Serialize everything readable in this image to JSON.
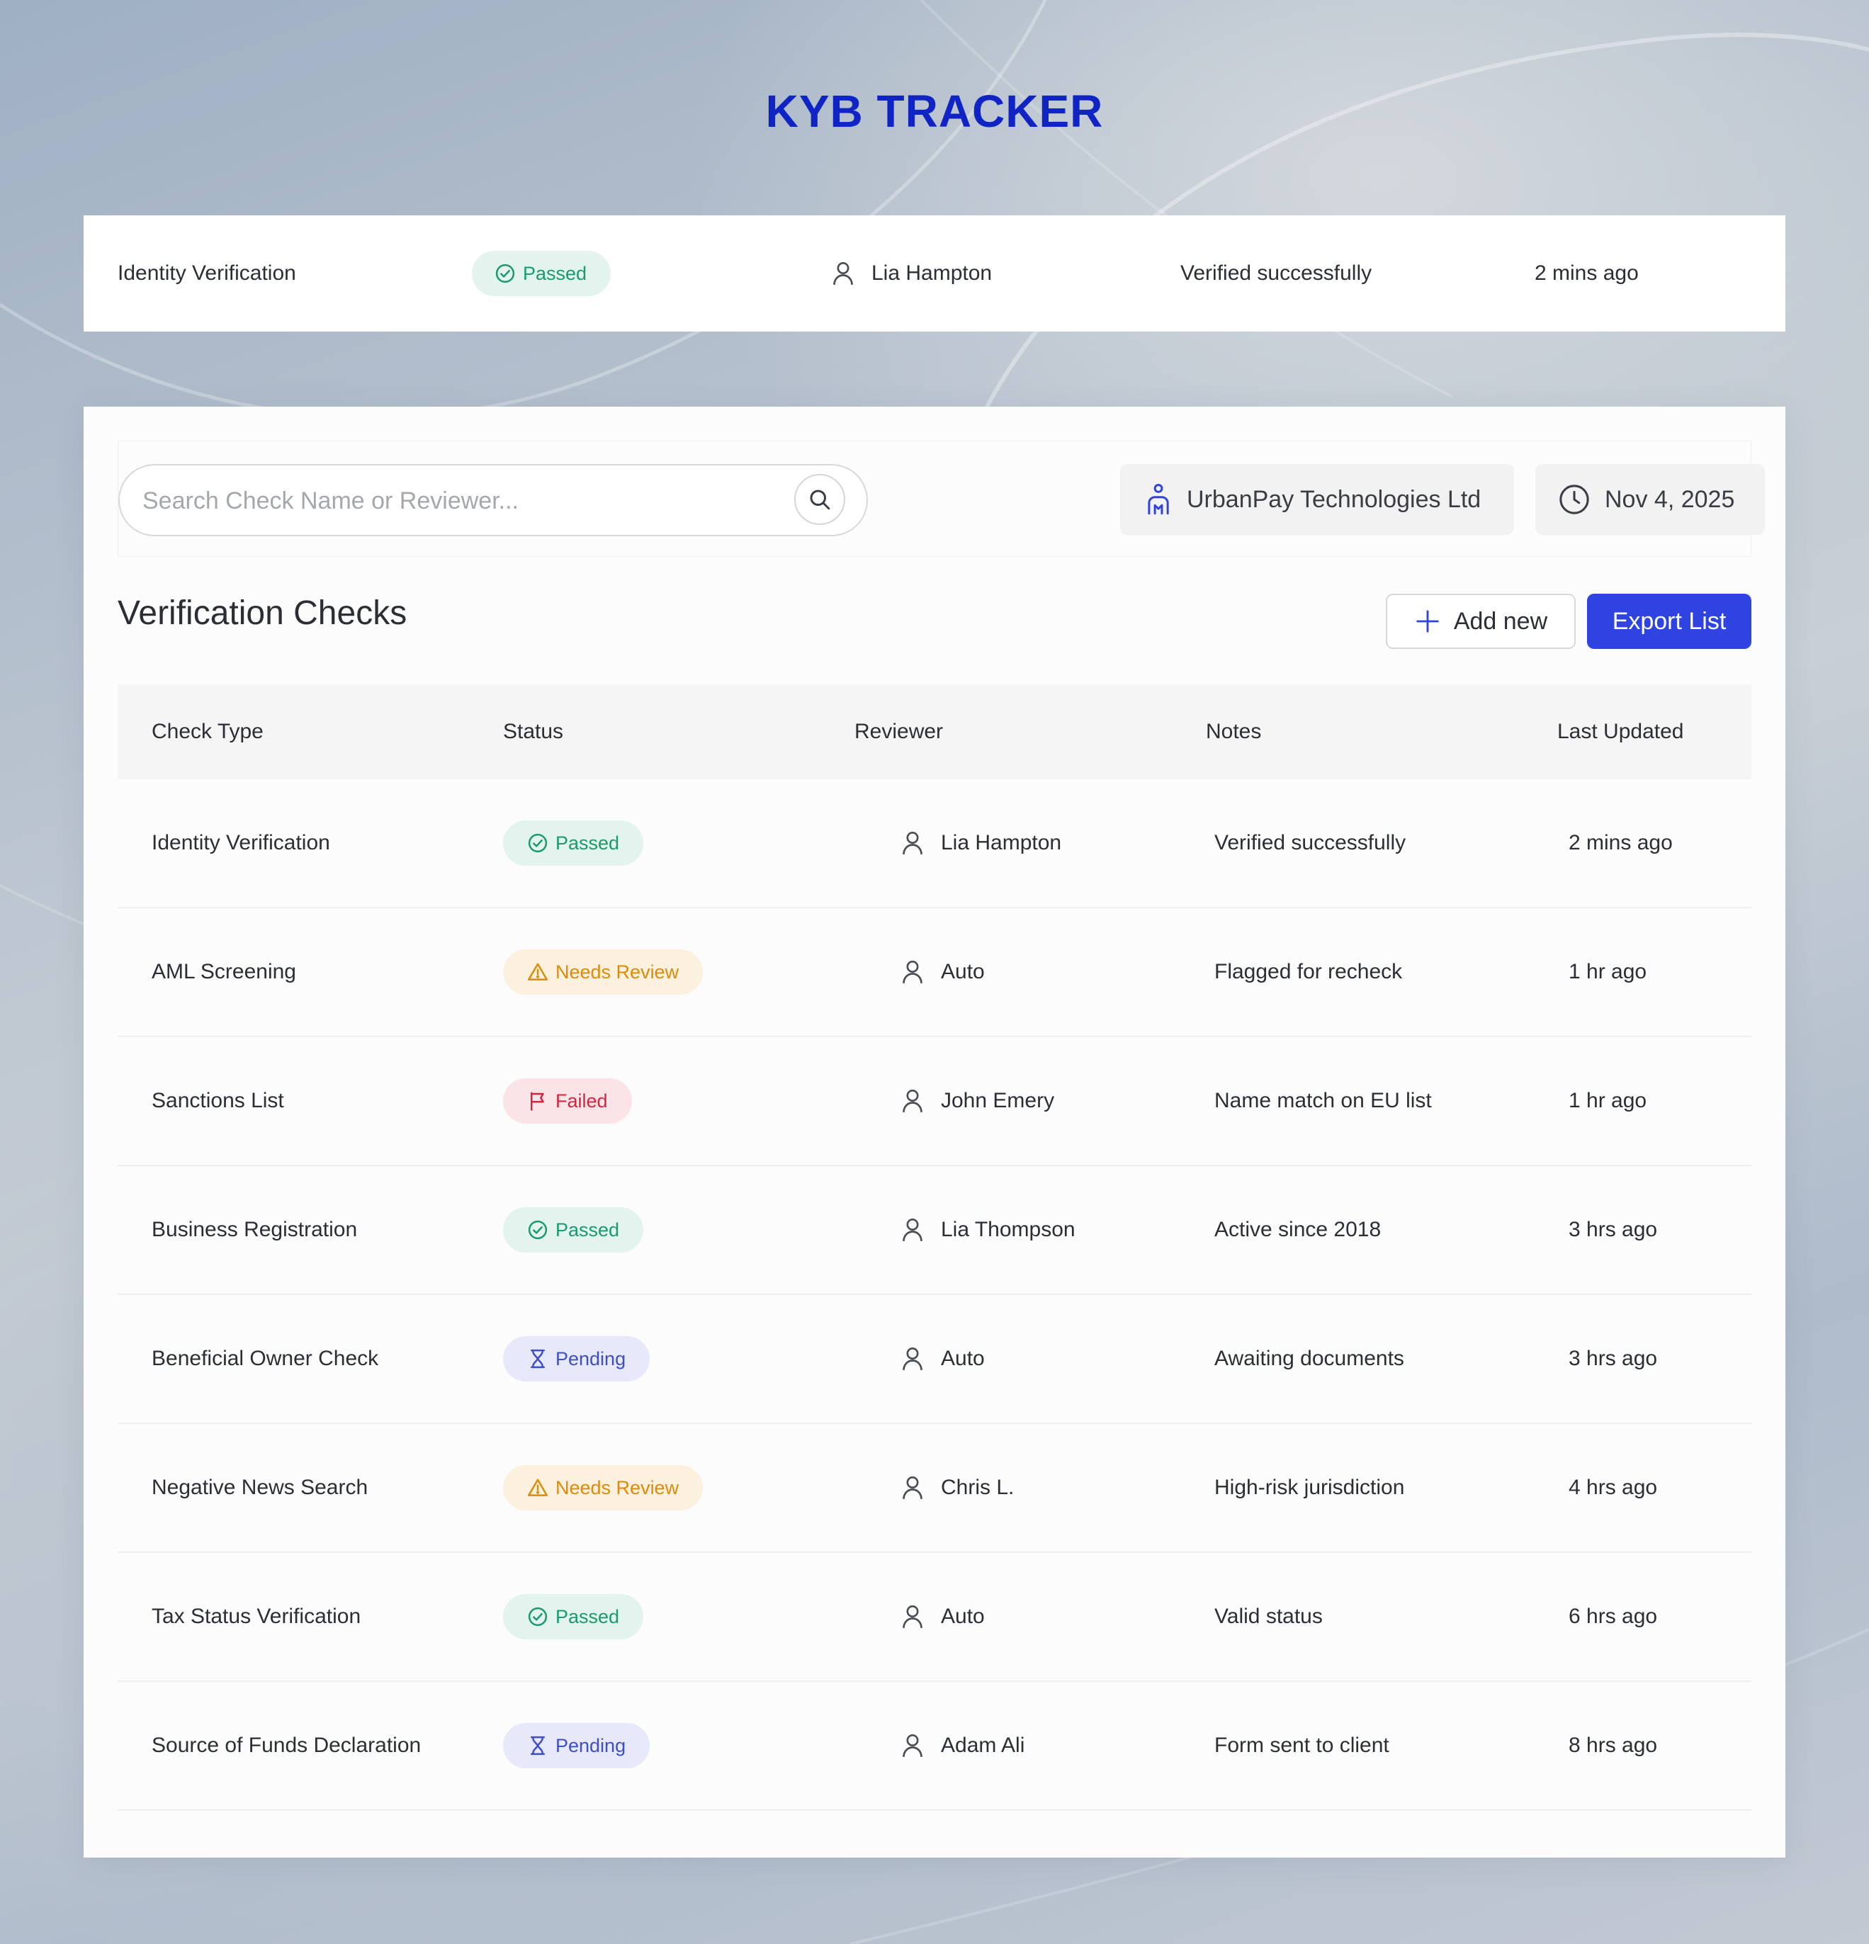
{
  "page": {
    "title": "KYB TRACKER"
  },
  "colors": {
    "accent": "#1024c5",
    "primary_button": "#2f43e0",
    "passed": "#1b9a6c",
    "needs_review": "#dc8c0a",
    "failed": "#d6263f",
    "pending": "#3e4fc6"
  },
  "summary": {
    "check_type": "Identity Verification",
    "status": "Passed",
    "status_icon": "check-circle-icon",
    "reviewer": "Lia Hampton",
    "notes": "Verified successfully",
    "last_updated": "2 mins ago"
  },
  "toolbar": {
    "search_placeholder": "Search Check Name or Reviewer...",
    "company": "UrbanPay Technologies Ltd",
    "company_icon": "person-icon",
    "date": "Nov 4, 2025",
    "date_icon": "clock-icon"
  },
  "section": {
    "title": "Verification Checks",
    "add_label": "Add new",
    "export_label": "Export List"
  },
  "table": {
    "headers": {
      "check_type": "Check Type",
      "status": "Status",
      "reviewer": "Reviewer",
      "notes": "Notes",
      "last_updated": "Last Updated"
    },
    "rows": [
      {
        "check_type": "Identity Verification",
        "status": "Passed",
        "status_kind": "passed",
        "status_icon": "check-circle-icon",
        "reviewer": "Lia Hampton",
        "notes": "Verified successfully",
        "last_updated": "2 mins ago"
      },
      {
        "check_type": "AML Screening",
        "status": "Needs Review",
        "status_kind": "review",
        "status_icon": "warning-triangle-icon",
        "reviewer": "Auto",
        "notes": "Flagged for recheck",
        "last_updated": "1 hr ago"
      },
      {
        "check_type": "Sanctions List",
        "status": "Failed",
        "status_kind": "failed",
        "status_icon": "flag-icon",
        "reviewer": "John Emery",
        "notes": "Name match on EU list",
        "last_updated": "1 hr ago"
      },
      {
        "check_type": "Business Registration",
        "status": "Passed",
        "status_kind": "passed",
        "status_icon": "check-circle-icon",
        "reviewer": "Lia Thompson",
        "notes": "Active since 2018",
        "last_updated": "3 hrs ago"
      },
      {
        "check_type": "Beneficial Owner Check",
        "status": "Pending",
        "status_kind": "pending",
        "status_icon": "hourglass-icon",
        "reviewer": "Auto",
        "notes": "Awaiting documents",
        "last_updated": "3 hrs ago"
      },
      {
        "check_type": "Negative News Search",
        "status": "Needs Review",
        "status_kind": "review",
        "status_icon": "warning-triangle-icon",
        "reviewer": "Chris L.",
        "notes": "High-risk jurisdiction",
        "last_updated": "4 hrs ago"
      },
      {
        "check_type": "Tax Status Verification",
        "status": "Passed",
        "status_kind": "passed",
        "status_icon": "check-circle-icon",
        "reviewer": "Auto",
        "notes": "Valid status",
        "last_updated": "6 hrs ago"
      },
      {
        "check_type": "Source of Funds Declaration",
        "status": "Pending",
        "status_kind": "pending",
        "status_icon": "hourglass-icon",
        "reviewer": "Adam Ali",
        "notes": "Form sent to client",
        "last_updated": "8 hrs ago"
      }
    ]
  }
}
